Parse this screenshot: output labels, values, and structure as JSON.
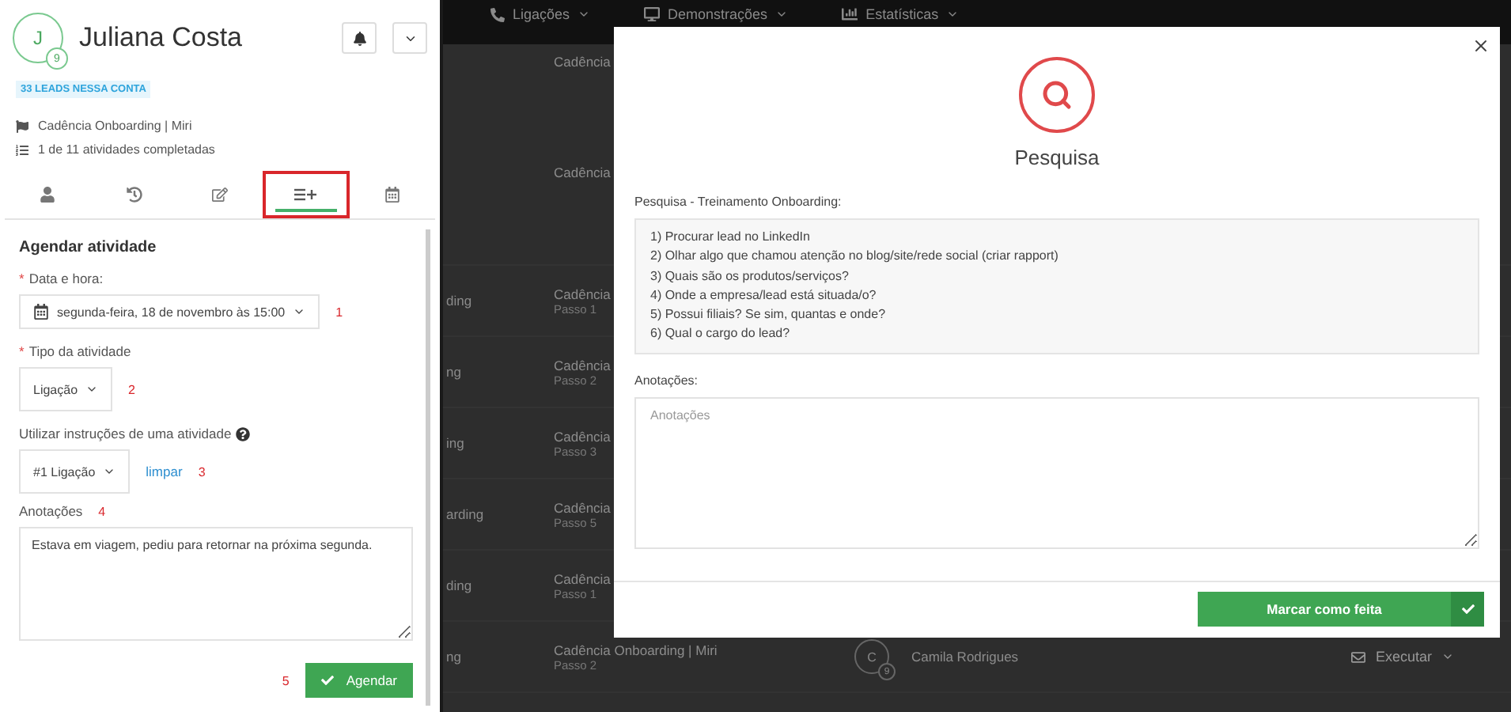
{
  "background": {
    "nav": [
      {
        "label": "Ligações"
      },
      {
        "label": "Demonstrações"
      },
      {
        "label": "Estatísticas"
      }
    ],
    "column_header": "Cadência",
    "rows": [
      {
        "fragment": "",
        "cadence": "Cadência",
        "step": ""
      },
      {
        "fragment": "ding",
        "cadence": "Cadência",
        "step": "Passo 1"
      },
      {
        "fragment": "ng",
        "cadence": "Cadência",
        "step": "Passo 2"
      },
      {
        "fragment": "ing",
        "cadence": "Cadência",
        "step": "Passo 3"
      },
      {
        "fragment": "arding",
        "cadence": "Cadência",
        "step": "Passo 5"
      },
      {
        "fragment": "ding",
        "cadence": "Cadência",
        "step": "Passo 1"
      },
      {
        "fragment": "ng",
        "cadence": "Cadência Onboarding | Miri",
        "step": "Passo 2",
        "lead": "Camila Rodrigues",
        "avatar": "C",
        "avatar_badge": "9",
        "action": "Executar"
      }
    ]
  },
  "lead_panel": {
    "avatar": "J",
    "avatar_badge": "9",
    "name": "Juliana Costa",
    "leads_badge": "33 LEADS NESSA CONTA",
    "cadence": "Cadência Onboarding | Miri",
    "progress": "1 de 11 atividades completadas",
    "tabs": [
      {
        "kind": "person",
        "selected": false,
        "highlighted": false
      },
      {
        "kind": "history",
        "selected": false,
        "highlighted": false
      },
      {
        "kind": "edit",
        "selected": false,
        "highlighted": false
      },
      {
        "kind": "schedule",
        "selected": true,
        "highlighted": true
      },
      {
        "kind": "calendar",
        "selected": false,
        "highlighted": false
      }
    ],
    "form": {
      "title": "Agendar atividade",
      "date_label": "Data e hora:",
      "date_required_mark": "*",
      "date_value": "segunda-feira, 18 de novembro às 15:00",
      "date_marker": "1",
      "type_label": "Tipo da atividade",
      "type_required_mark": "*",
      "type_value": "Ligação",
      "type_marker": "2",
      "instructions_label": "Utilizar instruções de uma atividade",
      "instructions_value": "#1 Ligação",
      "clear_link": "limpar",
      "instructions_marker": "3",
      "notes_label": "Anotações",
      "notes_marker": "4",
      "notes_value": "Estava em viagem, pediu para retornar na próxima segunda.",
      "submit_marker": "5",
      "submit": "Agendar"
    }
  },
  "modal": {
    "title": "Pesquisa",
    "instructions_label": "Pesquisa - Treinamento Onboarding:",
    "instructions": [
      "1) Procurar lead no LinkedIn",
      "2) Olhar algo que chamou atenção no blog/site/rede social (criar rapport)",
      "3) Quais são os produtos/serviços?",
      "4) Onde a empresa/lead está situada/o?",
      "5) Possui filiais? Se sim, quantas e onde?",
      "6) Qual o cargo do lead?"
    ],
    "notes_label": "Anotações:",
    "notes_placeholder": "Anotações",
    "submit": "Marcar como feita"
  }
}
